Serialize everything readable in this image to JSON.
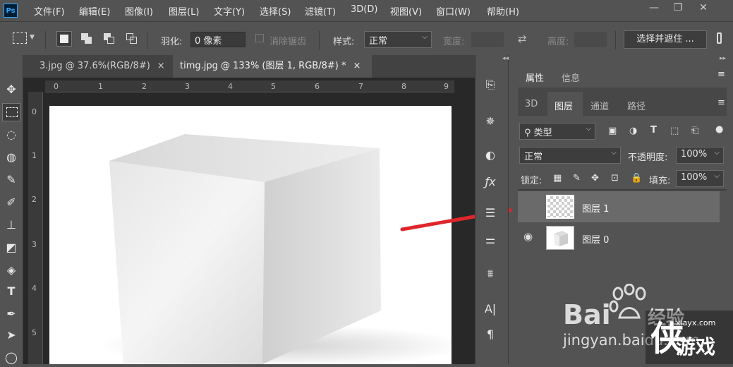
{
  "app": {
    "logo_text": "Ps"
  },
  "menu": [
    "文件(F)",
    "编辑(E)",
    "图像(I)",
    "图层(L)",
    "文字(Y)",
    "选择(S)",
    "滤镜(T)",
    "3D(D)",
    "视图(V)",
    "窗口(W)",
    "帮助(H)"
  ],
  "window_controls": {
    "minimize": "—",
    "restore": "❐",
    "close": "✕"
  },
  "options_bar": {
    "feather_label": "羽化:",
    "feather_value": "0 像素",
    "antialias_label": "消除锯齿",
    "style_label": "样式:",
    "style_value": "正常",
    "width_label": "宽度:",
    "height_label": "高度:",
    "select_mask_button": "选择并遮住 ..."
  },
  "tabs": [
    {
      "label": "3.jpg @ 37.6%(RGB/8#)",
      "close": "×",
      "active": false
    },
    {
      "label": "timg.jpg @ 133% (图层 1, RGB/8#) *",
      "close": "×",
      "active": true
    }
  ],
  "ruler": {
    "h": [
      "0",
      "1",
      "2",
      "3",
      "4",
      "5",
      "6",
      "7",
      "8",
      "9"
    ],
    "v": [
      "0",
      "1",
      "2",
      "3",
      "4",
      "5"
    ]
  },
  "panels": {
    "top_tabs": [
      "属性",
      "信息"
    ],
    "layer_tabs": [
      "3D",
      "图层",
      "通道",
      "路径"
    ],
    "filter_kind": "类型",
    "blend_mode": "正常",
    "opacity_label": "不透明度:",
    "opacity_value": "100%",
    "lock_label": "锁定:",
    "fill_label": "填充:",
    "fill_value": "100%"
  },
  "layers": [
    {
      "name": "图层 1",
      "visible": false,
      "selected": true
    },
    {
      "name": "图层 0",
      "visible": true,
      "selected": false
    }
  ],
  "watermark": {
    "baidu": "Bai",
    "baidu_suffix": "经验",
    "jingyan_url": "jingyan.baidu.com",
    "site": "xiayx.com",
    "site_name": "游戏"
  },
  "colors": {
    "accent_arrow": "#e0252b",
    "panel_bg": "#535353",
    "selected_layer": "#6a6a6a"
  }
}
